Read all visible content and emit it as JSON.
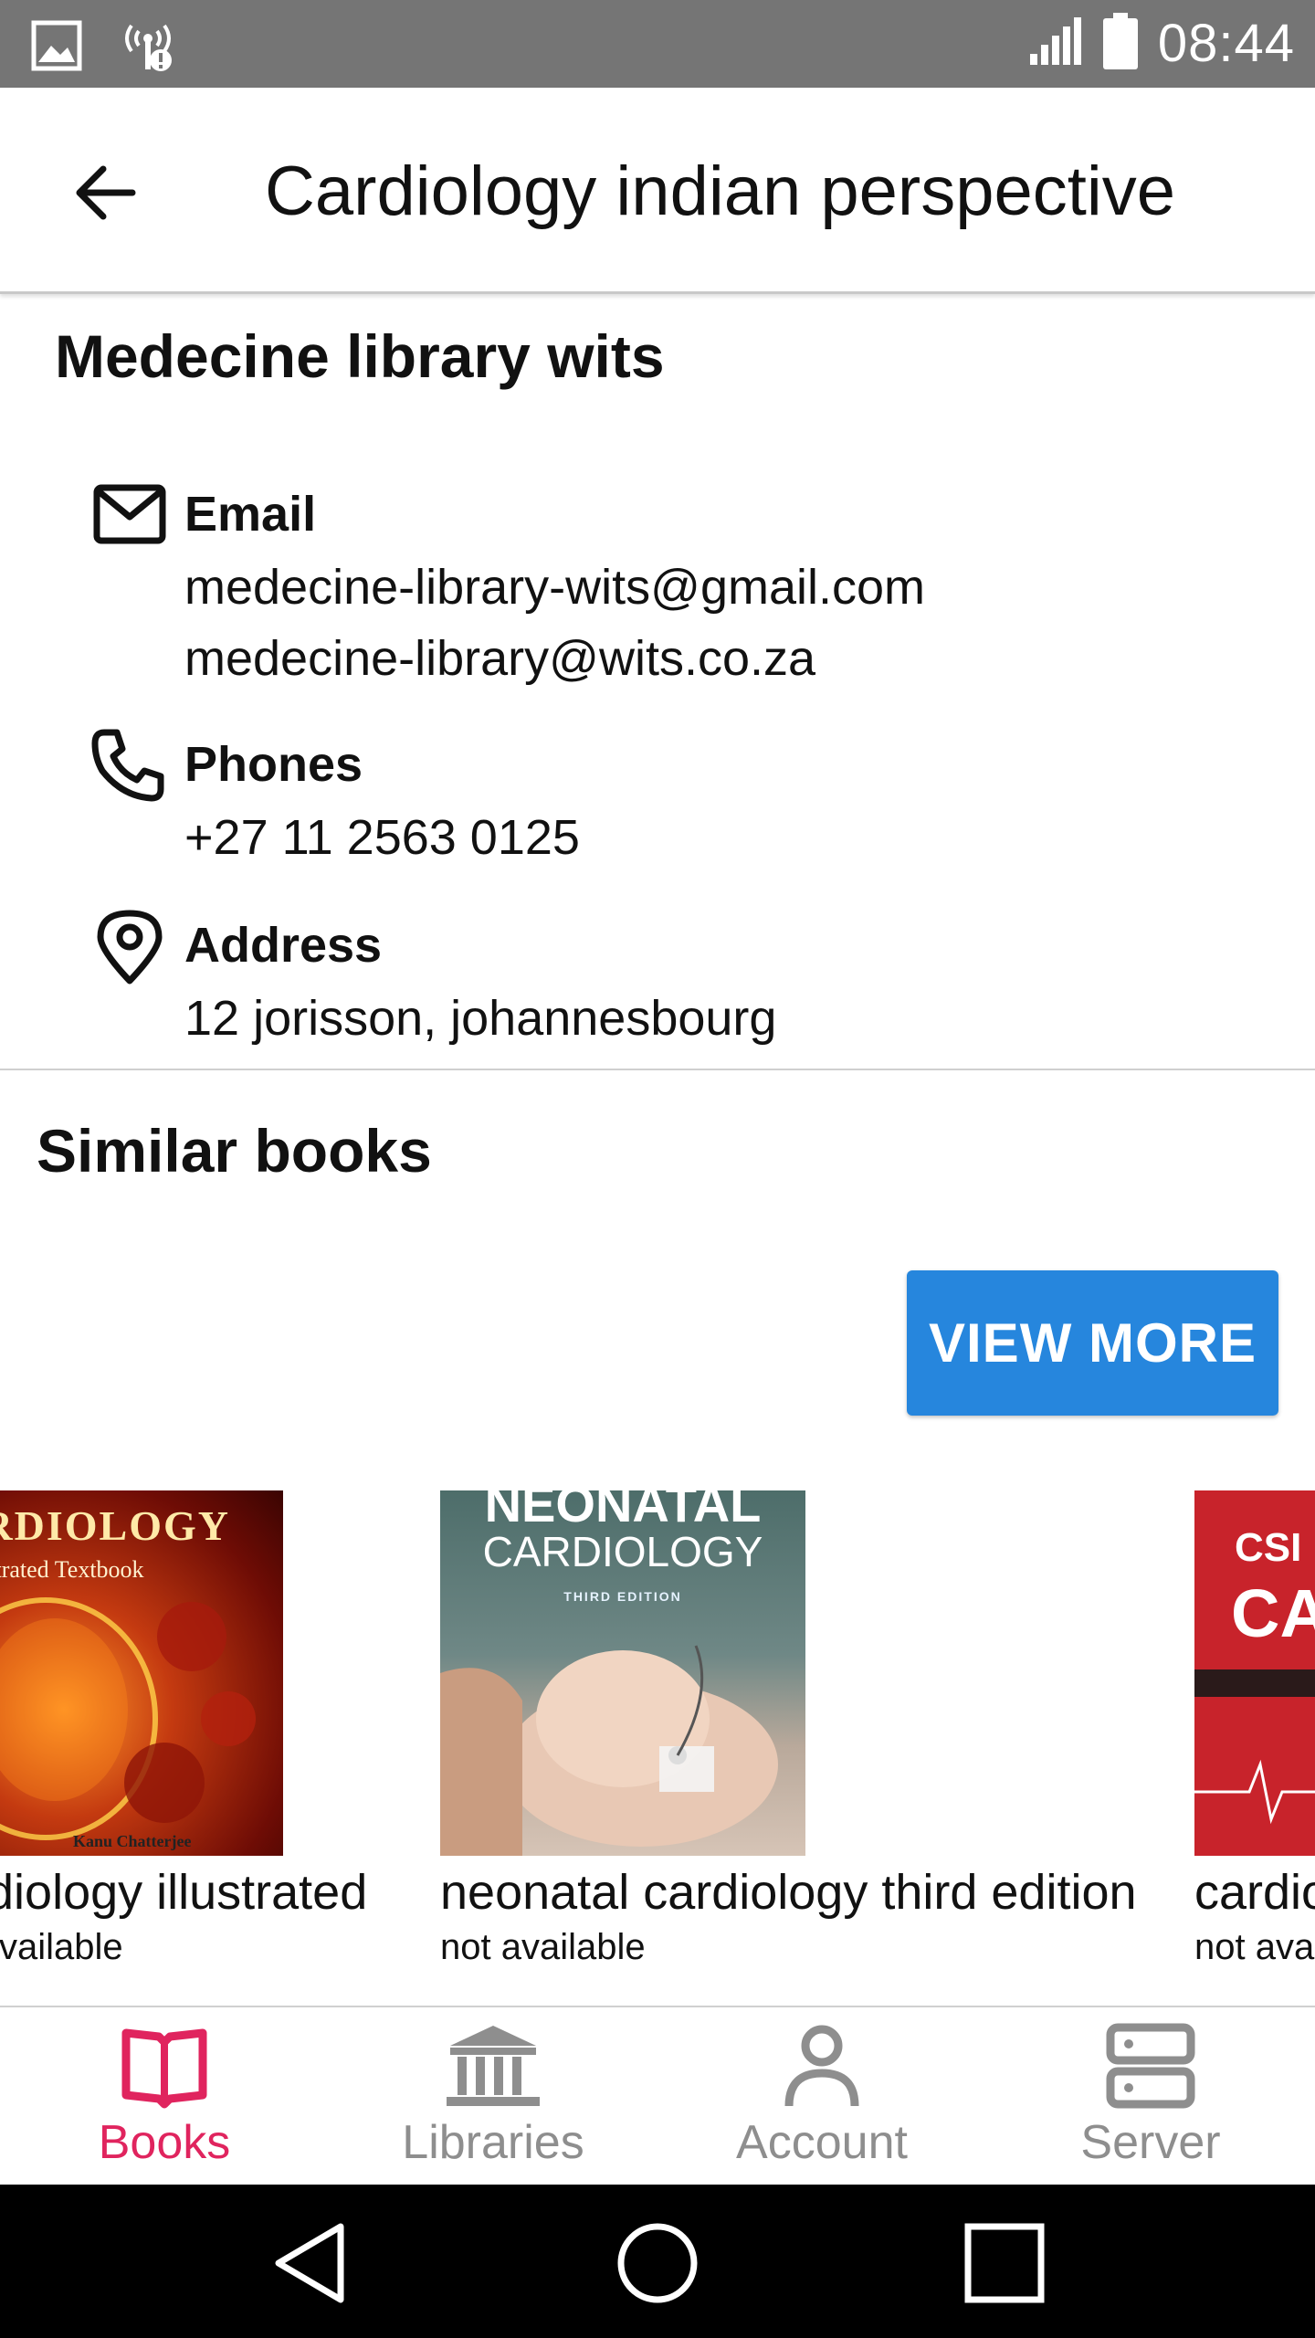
{
  "status_bar": {
    "time": "08:44"
  },
  "app_bar": {
    "title": "Cardiology indian perspective"
  },
  "library": {
    "name": "Medecine library wits",
    "email_label": "Email",
    "emails": [
      "medecine-library-wits@gmail.com",
      "medecine-library@wits.co.za"
    ],
    "phones_label": "Phones",
    "phones": [
      "+27 11 2563 0125"
    ],
    "address_label": "Address",
    "address": "12 jorisson, johannesbourg"
  },
  "similar": {
    "title": "Similar books",
    "view_more_label": "VIEW MORE",
    "books": [
      {
        "title": "cardiology illustrated",
        "status": "not available",
        "cover_lines": [
          "CARDIOLOGY",
          "An Illustrated Textbook",
          "Kanu Chatterjee"
        ]
      },
      {
        "title": "neonatal cardiology third edition",
        "status": "not available",
        "cover_lines": [
          "NEONATAL",
          "CARDIOLOGY",
          "THIRD EDITION"
        ]
      },
      {
        "title": "cardiology",
        "status": "not available",
        "cover_lines": [
          "CSI",
          "CAR"
        ]
      }
    ]
  },
  "bottom_nav": [
    {
      "label": "Books",
      "icon": "book-open-icon",
      "active": true
    },
    {
      "label": "Libraries",
      "icon": "library-building-icon",
      "active": false
    },
    {
      "label": "Account",
      "icon": "person-icon",
      "active": false
    },
    {
      "label": "Server",
      "icon": "server-icon",
      "active": false
    }
  ],
  "colors": {
    "accent": "#e0245e",
    "button": "#2686dd",
    "status_bar": "#757575",
    "inactive": "#8e8e8e"
  }
}
